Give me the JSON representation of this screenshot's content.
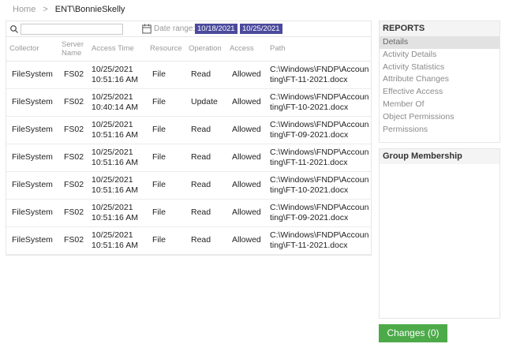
{
  "breadcrumb": {
    "home": "Home",
    "separator": ">",
    "current": "ENT\\BonnieSkelly"
  },
  "toolbar": {
    "search_placeholder": "",
    "date_label": "Date range:",
    "date_start": "10/18/2021",
    "date_end": "10/25/2021"
  },
  "table": {
    "headers": [
      "Collector",
      "Server Name",
      "Access Time",
      "Resource",
      "Operation",
      "Access",
      "Path"
    ],
    "rows": [
      [
        "FileSystem",
        "FS02",
        "10/25/2021 10:51:16 AM",
        "File",
        "Read",
        "Allowed",
        "C:\\Windows\\FNDP\\Accounting\\FT-11-2021.docx"
      ],
      [
        "FileSystem",
        "FS02",
        "10/25/2021 10:40:14 AM",
        "File",
        "Update",
        "Allowed",
        "C:\\Windows\\FNDP\\Accounting\\FT-10-2021.docx"
      ],
      [
        "FileSystem",
        "FS02",
        "10/25/2021 10:51:16 AM",
        "File",
        "Read",
        "Allowed",
        "C:\\Windows\\FNDP\\Accounting\\FT-09-2021.docx"
      ],
      [
        "FileSystem",
        "FS02",
        "10/25/2021 10:51:16 AM",
        "File",
        "Read",
        "Allowed",
        "C:\\Windows\\FNDP\\Accounting\\FT-11-2021.docx"
      ],
      [
        "FileSystem",
        "FS02",
        "10/25/2021 10:51:16 AM",
        "File",
        "Read",
        "Allowed",
        "C:\\Windows\\FNDP\\Accounting\\FT-10-2021.docx"
      ],
      [
        "FileSystem",
        "FS02",
        "10/25/2021 10:51:16 AM",
        "File",
        "Read",
        "Allowed",
        "C:\\Windows\\FNDP\\Accounting\\FT-09-2021.docx"
      ],
      [
        "FileSystem",
        "FS02",
        "10/25/2021 10:51:16 AM",
        "File",
        "Read",
        "Allowed",
        "C:\\Windows\\FNDP\\Accounting\\FT-11-2021.docx"
      ]
    ]
  },
  "reports": {
    "title": "REPORTS",
    "items": [
      "Details",
      "Activity Details",
      "Activity Statistics",
      "Attribute Changes",
      "Effective Access",
      "Member Of",
      "Object Permissions",
      "Permissions"
    ],
    "active_index": 0
  },
  "group_membership": {
    "title": "Group Membership"
  },
  "changes_button": {
    "label": "Changes (0)"
  },
  "colors": {
    "chip": "#4b4a9c",
    "button": "#4caa49",
    "active_item": "#e2e2e2"
  },
  "icons": {
    "search": "search-icon",
    "calendar": "calendar-icon"
  }
}
